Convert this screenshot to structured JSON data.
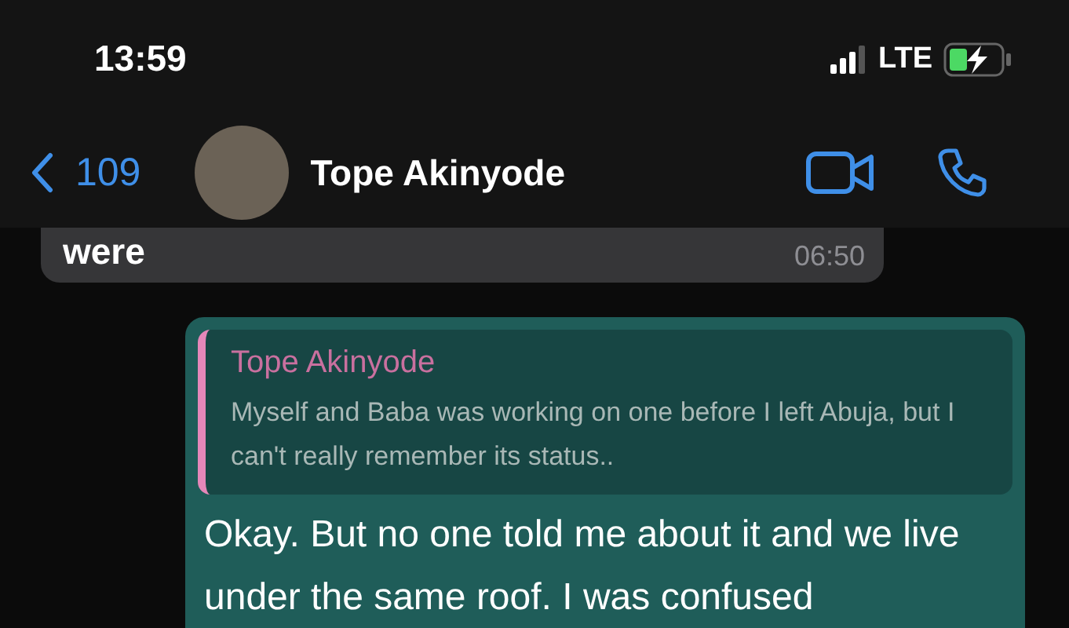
{
  "status_bar": {
    "time": "13:59",
    "network": "LTE"
  },
  "header": {
    "back_count": "109",
    "contact_name": "Tope Akinyode"
  },
  "messages": [
    {
      "kind": "incoming",
      "text": "were",
      "time": "06:50"
    },
    {
      "kind": "outgoing",
      "quote": {
        "author": "Tope Akinyode",
        "text": "Myself and Baba was working on one before I left Abuja, but I can't really remember its status.."
      },
      "text": "Okay. But no one told me about it and we live under the same roof. I was confused"
    }
  ]
}
